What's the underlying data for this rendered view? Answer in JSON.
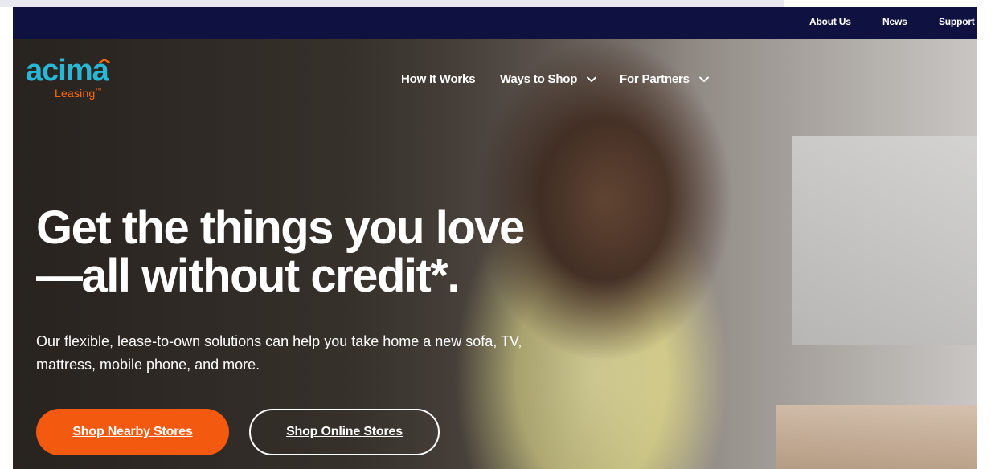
{
  "utility_nav": {
    "items": [
      {
        "label": "About Us"
      },
      {
        "label": "News"
      },
      {
        "label": "Support"
      }
    ]
  },
  "brand": {
    "name": "acima",
    "sub": "Leasing",
    "tm": "™",
    "colors": {
      "logo_blue": "#28b8d6",
      "logo_orange": "#ff6a00"
    }
  },
  "main_nav": {
    "items": [
      {
        "label": "How It Works",
        "has_dropdown": false
      },
      {
        "label": "Ways to Shop",
        "has_dropdown": true
      },
      {
        "label": "For Partners",
        "has_dropdown": true
      }
    ]
  },
  "hero": {
    "headline_line1": "Get the things you love",
    "headline_line2": "—all without credit*.",
    "subcopy": "Our flexible, lease-to-own solutions can help you take home a new sofa, TV, mattress, mobile phone, and more.",
    "buttons": {
      "primary": "Shop Nearby Stores",
      "secondary": "Shop Online Stores"
    }
  },
  "theme": {
    "utility_bar_bg": "#0f1240",
    "primary_button": "#f45a0f",
    "text": "#ffffff"
  }
}
